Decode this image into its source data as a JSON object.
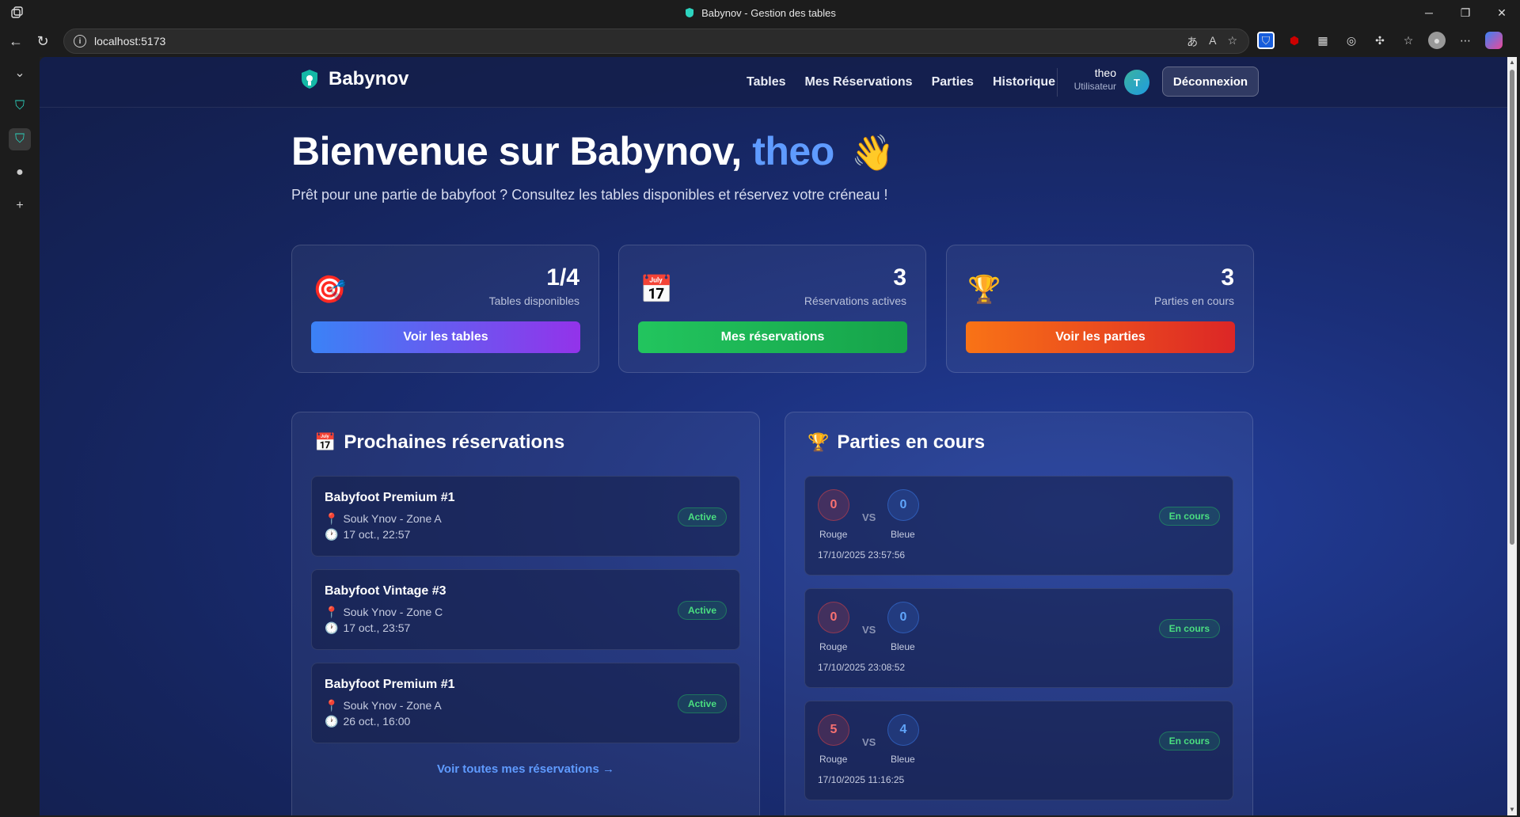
{
  "browser": {
    "tab_title": "Babynov - Gestion des tables",
    "url": "localhost:5173"
  },
  "app": {
    "brand": "Babynov",
    "nav": [
      "Tables",
      "Mes Réservations",
      "Parties",
      "Historique"
    ],
    "user": {
      "name": "theo",
      "role": "Utilisateur",
      "initial": "T"
    },
    "logout": "Déconnexion"
  },
  "hero": {
    "title_prefix": "Bienvenue sur Babynov, ",
    "title_name": "theo",
    "wave": "👋",
    "subtitle": "Prêt pour une partie de babyfoot ? Consultez les tables disponibles et réservez votre créneau !"
  },
  "stats": [
    {
      "icon": "🎯",
      "value": "1/4",
      "label": "Tables disponibles",
      "button": "Voir les tables",
      "color": "#4f7cf7"
    },
    {
      "icon": "📅",
      "value": "3",
      "label": "Réservations actives",
      "button": "Mes réservations",
      "color": "#22c55e"
    },
    {
      "icon": "🏆",
      "value": "3",
      "label": "Parties en cours",
      "button": "Voir les parties",
      "color": "#f97316"
    }
  ],
  "reservations": {
    "icon": "📅",
    "title": "Prochaines réservations",
    "items": [
      {
        "name": "Babyfoot Premium #1",
        "location": "Souk Ynov - Zone A",
        "time": "17 oct., 22:57",
        "status": "Active"
      },
      {
        "name": "Babyfoot Vintage #3",
        "location": "Souk Ynov - Zone C",
        "time": "17 oct., 23:57",
        "status": "Active"
      },
      {
        "name": "Babyfoot Premium #1",
        "location": "Souk Ynov - Zone A",
        "time": "26 oct., 16:00",
        "status": "Active"
      }
    ],
    "see_all": "Voir toutes mes réservations →"
  },
  "games": {
    "icon": "🏆",
    "title": "Parties en cours",
    "vs": "VS",
    "red_label": "Rouge",
    "blue_label": "Bleue",
    "items": [
      {
        "red": "0",
        "blue": "0",
        "date": "17/10/2025 23:57:56",
        "status": "En cours"
      },
      {
        "red": "0",
        "blue": "0",
        "date": "17/10/2025 23:08:52",
        "status": "En cours"
      },
      {
        "red": "5",
        "blue": "4",
        "date": "17/10/2025 11:16:25",
        "status": "En cours"
      }
    ]
  }
}
